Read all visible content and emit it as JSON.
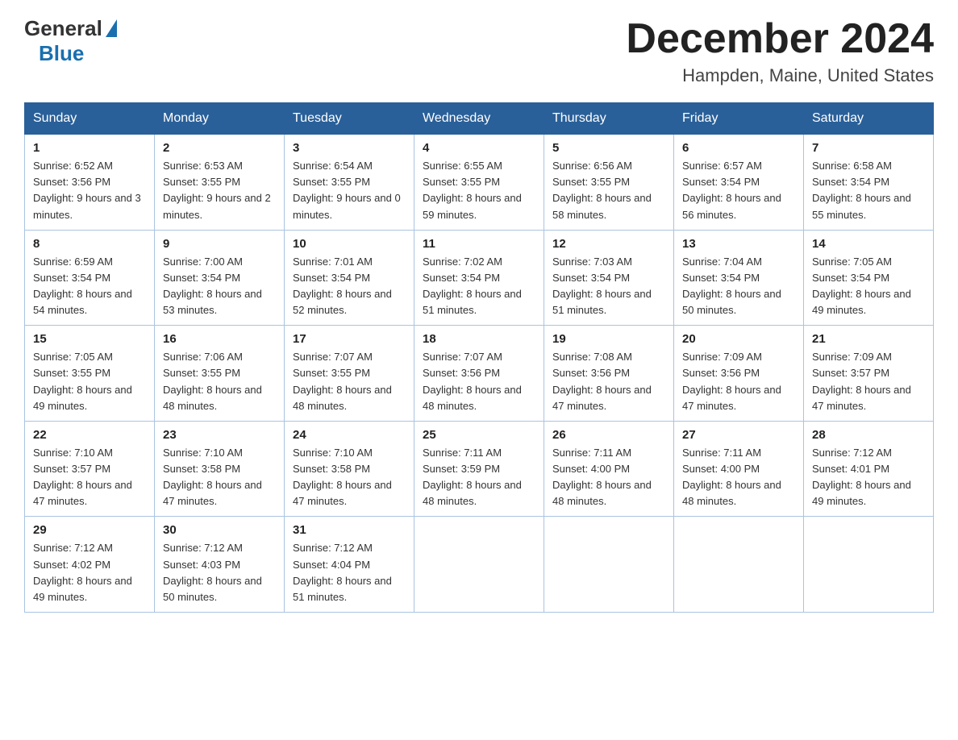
{
  "header": {
    "logo_general": "General",
    "logo_blue": "Blue",
    "month_title": "December 2024",
    "location": "Hampden, Maine, United States"
  },
  "days_of_week": [
    "Sunday",
    "Monday",
    "Tuesday",
    "Wednesday",
    "Thursday",
    "Friday",
    "Saturday"
  ],
  "weeks": [
    [
      {
        "day": "1",
        "sunrise": "6:52 AM",
        "sunset": "3:56 PM",
        "daylight": "9 hours and 3 minutes."
      },
      {
        "day": "2",
        "sunrise": "6:53 AM",
        "sunset": "3:55 PM",
        "daylight": "9 hours and 2 minutes."
      },
      {
        "day": "3",
        "sunrise": "6:54 AM",
        "sunset": "3:55 PM",
        "daylight": "9 hours and 0 minutes."
      },
      {
        "day": "4",
        "sunrise": "6:55 AM",
        "sunset": "3:55 PM",
        "daylight": "8 hours and 59 minutes."
      },
      {
        "day": "5",
        "sunrise": "6:56 AM",
        "sunset": "3:55 PM",
        "daylight": "8 hours and 58 minutes."
      },
      {
        "day": "6",
        "sunrise": "6:57 AM",
        "sunset": "3:54 PM",
        "daylight": "8 hours and 56 minutes."
      },
      {
        "day": "7",
        "sunrise": "6:58 AM",
        "sunset": "3:54 PM",
        "daylight": "8 hours and 55 minutes."
      }
    ],
    [
      {
        "day": "8",
        "sunrise": "6:59 AM",
        "sunset": "3:54 PM",
        "daylight": "8 hours and 54 minutes."
      },
      {
        "day": "9",
        "sunrise": "7:00 AM",
        "sunset": "3:54 PM",
        "daylight": "8 hours and 53 minutes."
      },
      {
        "day": "10",
        "sunrise": "7:01 AM",
        "sunset": "3:54 PM",
        "daylight": "8 hours and 52 minutes."
      },
      {
        "day": "11",
        "sunrise": "7:02 AM",
        "sunset": "3:54 PM",
        "daylight": "8 hours and 51 minutes."
      },
      {
        "day": "12",
        "sunrise": "7:03 AM",
        "sunset": "3:54 PM",
        "daylight": "8 hours and 51 minutes."
      },
      {
        "day": "13",
        "sunrise": "7:04 AM",
        "sunset": "3:54 PM",
        "daylight": "8 hours and 50 minutes."
      },
      {
        "day": "14",
        "sunrise": "7:05 AM",
        "sunset": "3:54 PM",
        "daylight": "8 hours and 49 minutes."
      }
    ],
    [
      {
        "day": "15",
        "sunrise": "7:05 AM",
        "sunset": "3:55 PM",
        "daylight": "8 hours and 49 minutes."
      },
      {
        "day": "16",
        "sunrise": "7:06 AM",
        "sunset": "3:55 PM",
        "daylight": "8 hours and 48 minutes."
      },
      {
        "day": "17",
        "sunrise": "7:07 AM",
        "sunset": "3:55 PM",
        "daylight": "8 hours and 48 minutes."
      },
      {
        "day": "18",
        "sunrise": "7:07 AM",
        "sunset": "3:56 PM",
        "daylight": "8 hours and 48 minutes."
      },
      {
        "day": "19",
        "sunrise": "7:08 AM",
        "sunset": "3:56 PM",
        "daylight": "8 hours and 47 minutes."
      },
      {
        "day": "20",
        "sunrise": "7:09 AM",
        "sunset": "3:56 PM",
        "daylight": "8 hours and 47 minutes."
      },
      {
        "day": "21",
        "sunrise": "7:09 AM",
        "sunset": "3:57 PM",
        "daylight": "8 hours and 47 minutes."
      }
    ],
    [
      {
        "day": "22",
        "sunrise": "7:10 AM",
        "sunset": "3:57 PM",
        "daylight": "8 hours and 47 minutes."
      },
      {
        "day": "23",
        "sunrise": "7:10 AM",
        "sunset": "3:58 PM",
        "daylight": "8 hours and 47 minutes."
      },
      {
        "day": "24",
        "sunrise": "7:10 AM",
        "sunset": "3:58 PM",
        "daylight": "8 hours and 47 minutes."
      },
      {
        "day": "25",
        "sunrise": "7:11 AM",
        "sunset": "3:59 PM",
        "daylight": "8 hours and 48 minutes."
      },
      {
        "day": "26",
        "sunrise": "7:11 AM",
        "sunset": "4:00 PM",
        "daylight": "8 hours and 48 minutes."
      },
      {
        "day": "27",
        "sunrise": "7:11 AM",
        "sunset": "4:00 PM",
        "daylight": "8 hours and 48 minutes."
      },
      {
        "day": "28",
        "sunrise": "7:12 AM",
        "sunset": "4:01 PM",
        "daylight": "8 hours and 49 minutes."
      }
    ],
    [
      {
        "day": "29",
        "sunrise": "7:12 AM",
        "sunset": "4:02 PM",
        "daylight": "8 hours and 49 minutes."
      },
      {
        "day": "30",
        "sunrise": "7:12 AM",
        "sunset": "4:03 PM",
        "daylight": "8 hours and 50 minutes."
      },
      {
        "day": "31",
        "sunrise": "7:12 AM",
        "sunset": "4:04 PM",
        "daylight": "8 hours and 51 minutes."
      },
      null,
      null,
      null,
      null
    ]
  ]
}
